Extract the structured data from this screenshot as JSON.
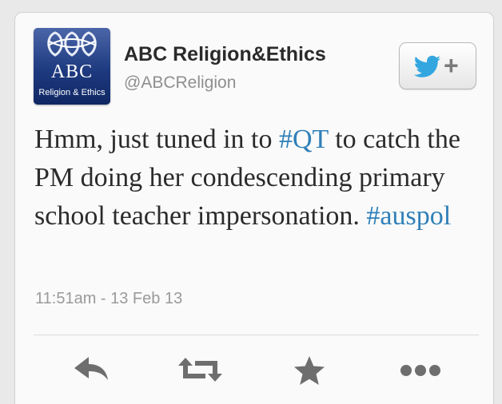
{
  "profile": {
    "display_name": "ABC Religion&Ethics",
    "handle": "@ABCReligion",
    "avatar": {
      "logo_text": "ABC",
      "subtitle": "Religion & Ethics",
      "bg_color": "#1e3a80"
    }
  },
  "follow_button": {
    "icon": "twitter-bird-icon",
    "symbol": "+",
    "bird_color": "#33a6e0"
  },
  "tweet": {
    "segments": [
      {
        "text": "Hmm, just tuned in to ",
        "type": "text"
      },
      {
        "text": "#QT",
        "type": "hashtag"
      },
      {
        "text": " to catch the PM doing her condescending primary school teacher impersonation. ",
        "type": "text"
      },
      {
        "text": "#auspol",
        "type": "hashtag"
      }
    ],
    "timestamp": "11:51am - 13 Feb 13",
    "hashtag_color": "#2f7fb8"
  },
  "actions": [
    {
      "name": "reply",
      "icon": "reply-icon"
    },
    {
      "name": "retweet",
      "icon": "retweet-icon"
    },
    {
      "name": "favorite",
      "icon": "star-icon"
    },
    {
      "name": "more",
      "icon": "more-icon"
    }
  ]
}
